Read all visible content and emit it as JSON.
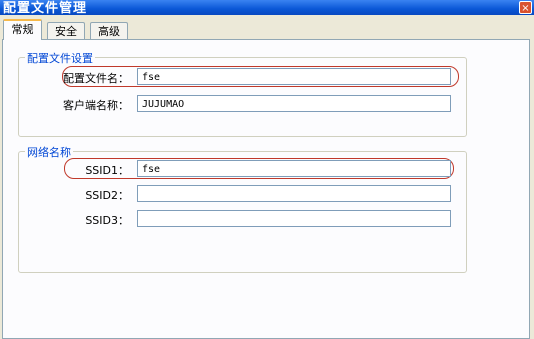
{
  "window": {
    "title": "配置文件管理",
    "close_glyph": "×"
  },
  "tabs": [
    {
      "label": "常规"
    },
    {
      "label": "安全"
    },
    {
      "label": "高级"
    }
  ],
  "profile_group": {
    "legend": "配置文件设置",
    "profile_name_label": "配置文件名：",
    "profile_name_value": "fse",
    "client_name_label": "客户端名称：",
    "client_name_value": "JUJUMAO"
  },
  "network_group": {
    "legend": "网络名称",
    "ssid1_label": "SSID1：",
    "ssid1_value": "fse",
    "ssid2_label": "SSID2：",
    "ssid2_value": "",
    "ssid3_label": "SSID3：",
    "ssid3_value": ""
  },
  "colors": {
    "titlebar": "#0a57d6",
    "legend": "#0046d5",
    "highlight": "#c0392b"
  }
}
